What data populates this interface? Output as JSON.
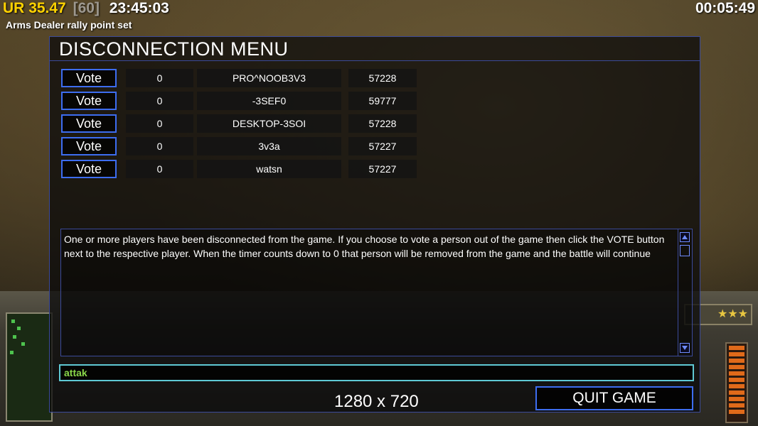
{
  "hud": {
    "ur_label": "UR",
    "ur_value": "35.47",
    "faded_text": "[60]",
    "clock": "23:45:03",
    "game_timer": "00:05:49",
    "notification": "Arms Dealer rally point set"
  },
  "dialog": {
    "title": "DISCONNECTION MENU",
    "vote_label": "Vote",
    "players": [
      {
        "count": "0",
        "name": "PRO^NOOB3V3",
        "port": "57228"
      },
      {
        "count": "0",
        "name": "-3SEF0",
        "port": "59777"
      },
      {
        "count": "0",
        "name": "DESKTOP-3SOI",
        "port": "57228"
      },
      {
        "count": "0",
        "name": "3v3a",
        "port": "57227"
      },
      {
        "count": "0",
        "name": "watsn",
        "port": "57227"
      }
    ],
    "message": "One or more players have been disconnected from the game. If you choose to vote a person out of the game then click the VOTE button next to the respective player. When the timer counts down to 0 that person will be removed from the game and the battle will continue",
    "chat_value": "attak",
    "resolution": "1280 x 720",
    "quit_label": "QUIT GAME"
  },
  "hud_extra": {
    "stars": "★★★"
  },
  "colors": {
    "accent_blue": "#3d6df0",
    "chat_border": "#5fc9d4",
    "chat_text": "#8ad84a",
    "ur_yellow": "#ffd200"
  }
}
